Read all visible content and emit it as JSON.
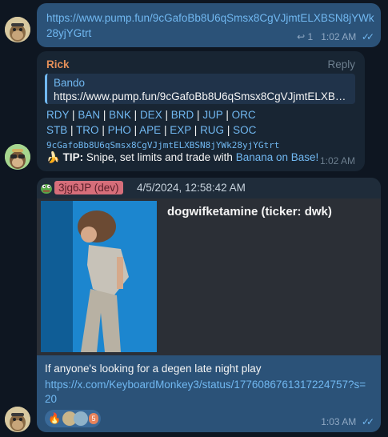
{
  "messages": [
    {
      "id": "m1",
      "direction": "outgoing",
      "text": "https://www.pump.fun/9cGafoBb8U6qSmsx8CgVJjmtELXBSN8jYWk28yjYGtrt",
      "reply_count": "1",
      "time": "1:02 AM",
      "status": "read"
    },
    {
      "id": "m2",
      "direction": "incoming",
      "sender": "Rick",
      "reply_label": "Reply",
      "quote": {
        "name": "Bando",
        "text": "https://www.pump.fun/9cGafoBb8U6qSmsx8CgVJjmtELXBSN..."
      },
      "links_row1": [
        "RDY",
        "BAN",
        "BNK",
        "DEX",
        "BRD",
        "JUP",
        "ORC"
      ],
      "links_row2": [
        "STB",
        "TRO",
        "PHO",
        "APE",
        "EXP",
        "RUG",
        "SOC"
      ],
      "address": "9cGafoBb8U6qSmsx8CgVJjmtELXBSN8jYWk28yjYGtrt",
      "tip_label": "TIP:",
      "tip_text": "Snipe, set limits and trade with",
      "tip_link": "Banana on Base!",
      "time": "1:02 AM"
    },
    {
      "id": "m3",
      "direction": "outgoing",
      "header": {
        "user": "3jg6JP (dev)",
        "date": "4/5/2024, 12:58:42 AM"
      },
      "card_title": "dogwifketamine (ticker: dwk)",
      "caption": "If anyone's looking for a degen late night play",
      "link": "https://x.com/KeyboardMonkey3/status/1776086761317224757?s=20",
      "reactions": {
        "emoji": "🔥",
        "count": "5"
      },
      "time": "1:03 AM",
      "status": "read"
    }
  ],
  "colors": {
    "background": "#0e1621",
    "outgoing_bubble": "#2b5278",
    "incoming_bubble": "#182533",
    "link": "#71b8f1",
    "sender_name": "#e38e58"
  }
}
